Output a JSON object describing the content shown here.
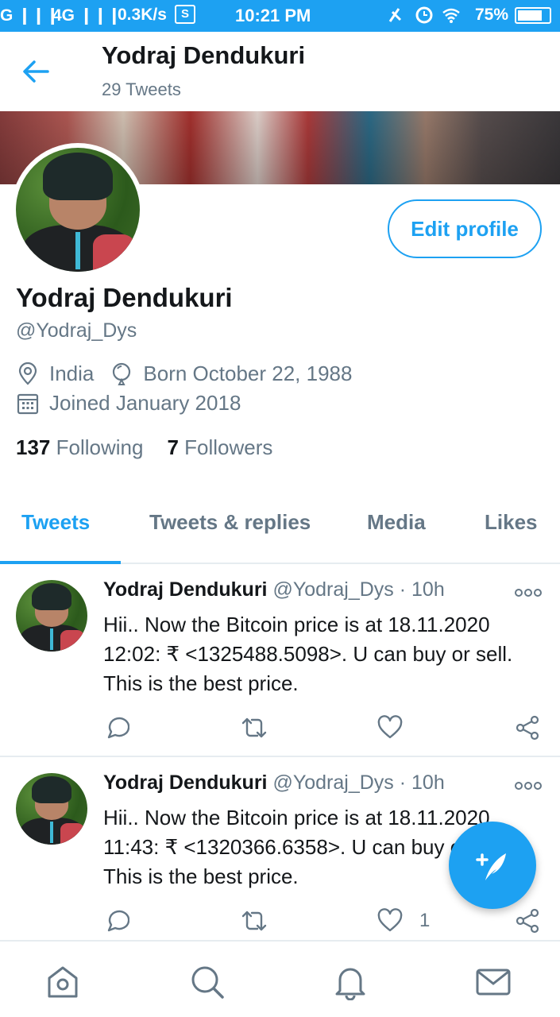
{
  "status_bar": {
    "signal": "G ❙❙❙",
    "network": "4G ❙❙❙",
    "speed": "0.3K/s",
    "sim": "S",
    "time": "10:21 PM",
    "battery": "75%"
  },
  "header": {
    "name": "Yodraj Dendukuri",
    "tweet_count": "29 Tweets"
  },
  "profile": {
    "name": "Yodraj Dendukuri",
    "handle": "@Yodraj_Dys",
    "edit_label": "Edit profile",
    "location": "India",
    "birth": "Born October 22, 1988",
    "joined": "Joined January 2018",
    "following_count": "137",
    "following_label": "Following",
    "followers_count": "7",
    "followers_label": "Followers"
  },
  "tabs": [
    {
      "label": "Tweets",
      "active": true
    },
    {
      "label": "Tweets & replies",
      "active": false
    },
    {
      "label": "Media",
      "active": false
    },
    {
      "label": "Likes",
      "active": false
    }
  ],
  "tweets": [
    {
      "name": "Yodraj Dendukuri",
      "handle": "@Yodraj_Dys",
      "time": "· 10h",
      "text": "Hii.. Now the Bitcoin price is at 18.11.2020 12:02: ₹ <1325488.5098>. U can buy or sell. This is the best price.",
      "like_count": ""
    },
    {
      "name": "Yodraj Dendukuri",
      "handle": "@Yodraj_Dys",
      "time": "· 10h",
      "text": "Hii.. Now the Bitcoin price is at 18.11.2020 11:43: ₹ <1320366.6358>. U can buy or sell. This is the best price.",
      "like_count": "1"
    }
  ],
  "icons": {
    "back": "arrow-left-icon",
    "location": "location-pin-icon",
    "birthday": "balloon-icon",
    "calendar": "calendar-icon",
    "reply": "reply-icon",
    "retweet": "retweet-icon",
    "like": "heart-icon",
    "share": "share-icon",
    "compose": "compose-tweet-icon",
    "home": "home-icon",
    "search": "search-icon",
    "notifications": "bell-icon",
    "messages": "mail-icon"
  },
  "colors": {
    "accent": "#1da1f2",
    "text": "#14171a",
    "muted": "#657786",
    "divider": "#e6ecf0"
  }
}
